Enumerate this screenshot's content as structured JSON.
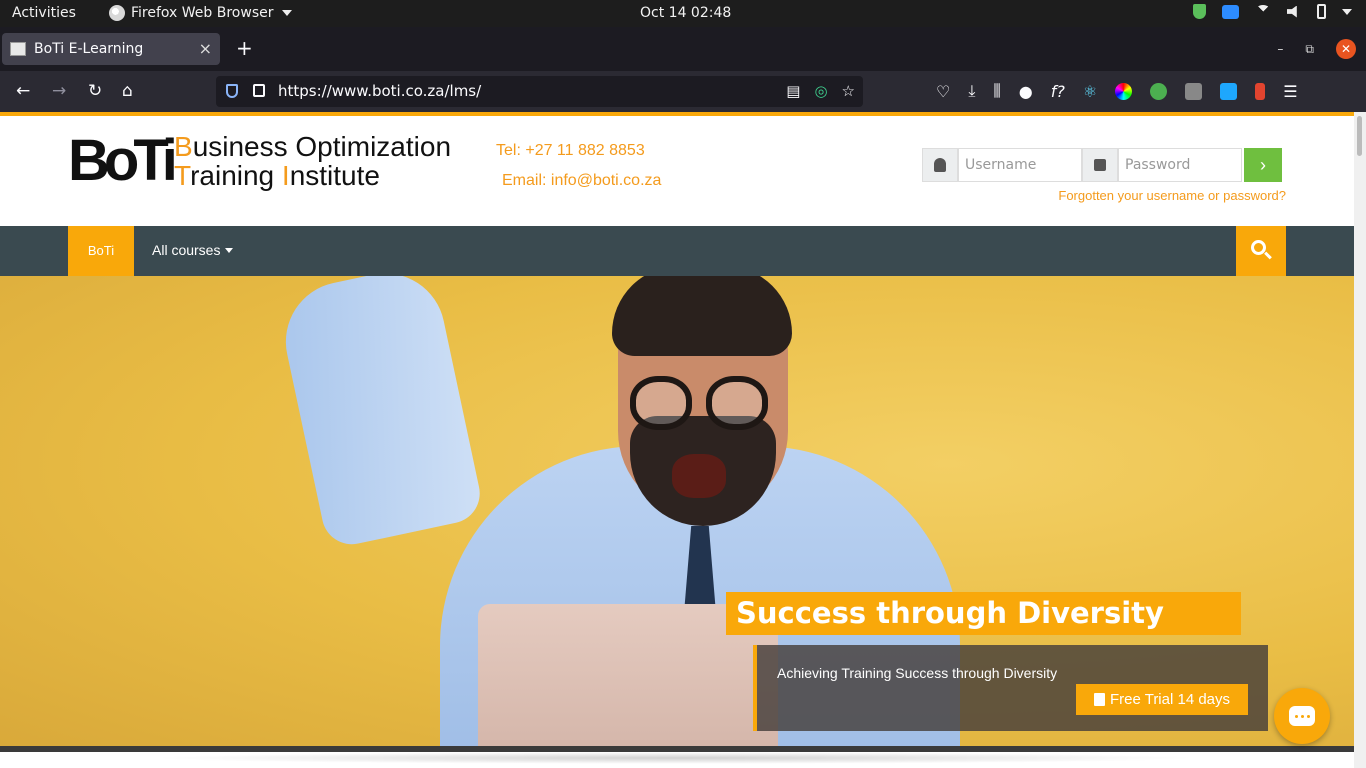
{
  "system_bar": {
    "activities": "Activities",
    "app_name": "Firefox Web Browser",
    "clock": "Oct 14  02:48"
  },
  "browser": {
    "tab_title": "BoTi E-Learning",
    "tab_close": "×",
    "new_tab": "+",
    "url": "https://www.boti.co.za/lms/",
    "window_controls": {
      "minimize": "–",
      "restore": "⧉",
      "close": "✕"
    }
  },
  "site": {
    "logo_mark": "BoTi",
    "logo_line1_initial": "B",
    "logo_line1_rest": "usiness Optimization",
    "logo_line2_initial": "T",
    "logo_line2_mid": "raining ",
    "logo_line2_initial2": "I",
    "logo_line2_rest": "nstitute",
    "phone": "Tel: +27 11 882  8853",
    "email": "Email: info@boti.co.za",
    "login": {
      "username_placeholder": "Username",
      "password_placeholder": "Password",
      "submit_icon": "›"
    },
    "forgot_link": "Forgotten your username or password?",
    "nav": {
      "home": "BoTi",
      "courses": "All courses"
    },
    "hero": {
      "title": "Success through Diversity",
      "subtitle": "Achieving Training Success through Diversity",
      "cta": "Free Trial 14 days"
    }
  },
  "colors": {
    "accent": "#f9a80a",
    "nav_bg": "#3a4a50",
    "login_go": "#6fbf3f"
  }
}
